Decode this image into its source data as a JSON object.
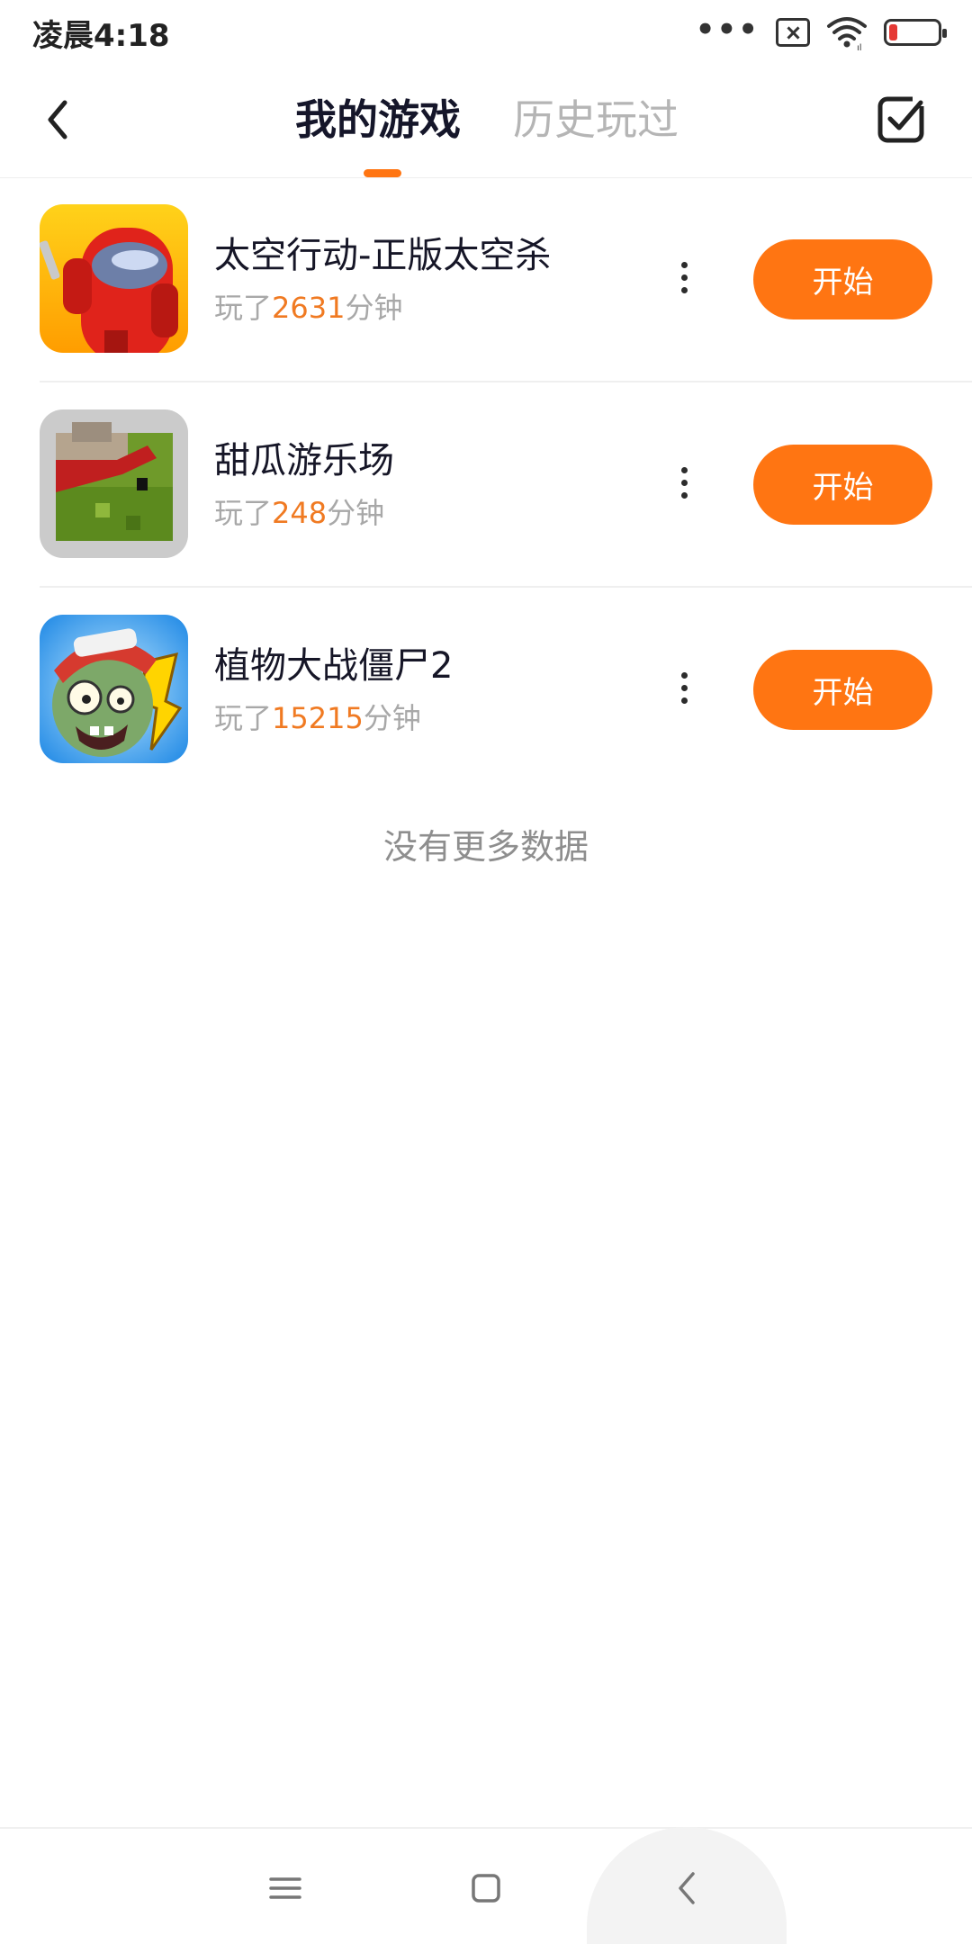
{
  "status_bar": {
    "time": "凌晨4:18",
    "icons": [
      "more-dots-icon",
      "no-sim-icon",
      "wifi-icon",
      "battery-low-icon"
    ],
    "battery_color": "#e53935"
  },
  "header": {
    "back_icon": "chevron-left-icon",
    "tabs": [
      {
        "label": "我的游戏",
        "active": true
      },
      {
        "label": "历史玩过",
        "active": false
      }
    ],
    "manage_icon": "checkbox-check-icon",
    "accent_color": "#ff7512"
  },
  "games": [
    {
      "title": "太空行动-正版太空杀",
      "played_prefix": "玩了",
      "minutes": "2631",
      "played_suffix": "分钟",
      "icon": "among-us-style-game-icon",
      "button_label": "开始"
    },
    {
      "title": "甜瓜游乐场",
      "played_prefix": "玩了",
      "minutes": "248",
      "played_suffix": "分钟",
      "icon": "melon-playground-game-icon",
      "button_label": "开始"
    },
    {
      "title": "植物大战僵尸2",
      "played_prefix": "玩了",
      "minutes": "15215",
      "played_suffix": "分钟",
      "icon": "plants-vs-zombies-game-icon",
      "button_label": "开始"
    }
  ],
  "footer_text": "没有更多数据",
  "nav_bar": {
    "icons": [
      "menu-icon",
      "home-square-icon",
      "back-chevron-icon"
    ]
  }
}
